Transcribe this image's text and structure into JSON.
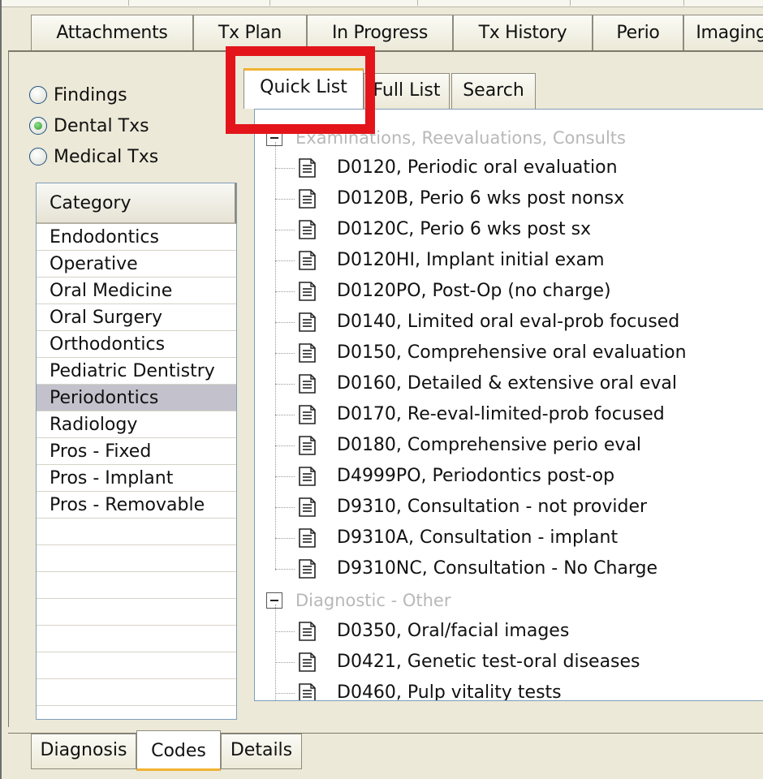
{
  "top_tabs": [
    "Attachments",
    "Tx Plan",
    "In Progress",
    "Tx History",
    "Perio",
    "Imaging"
  ],
  "radios": [
    {
      "label": "Findings",
      "checked": false
    },
    {
      "label": "Dental Txs",
      "checked": true
    },
    {
      "label": "Medical Txs",
      "checked": false
    }
  ],
  "category": {
    "header": "Category",
    "items": [
      "Endodontics",
      "Operative",
      "Oral Medicine",
      "Oral Surgery",
      "Orthodontics",
      "Pediatric Dentistry",
      "Periodontics",
      "Radiology",
      "Pros - Fixed",
      "Pros - Implant",
      "Pros - Removable"
    ],
    "selected": "Periodontics"
  },
  "inner_tabs": [
    "Quick List",
    "Full List",
    "Search"
  ],
  "active_inner_tab": "Quick List",
  "tree": {
    "group1": "Examinations, Reevaluations, Consults",
    "group1_items": [
      "D0120, Periodic oral evaluation",
      "D0120B, Perio 6 wks post nonsx",
      "D0120C, Perio 6 wks post sx",
      "D0120HI, Implant initial exam",
      "D0120PO, Post-Op (no charge)",
      "D0140, Limited oral eval-prob focused",
      "D0150, Comprehensive oral evaluation",
      "D0160, Detailed & extensive oral eval",
      "D0170, Re-eval-limited-prob focused",
      "D0180, Comprehensive perio eval",
      "D4999PO, Periodontics post-op",
      "D9310, Consultation - not provider",
      "D9310A, Consultation - implant",
      "D9310NC, Consultation - No Charge"
    ],
    "group2": "Diagnostic - Other",
    "group2_items": [
      "D0350, Oral/facial images",
      "D0421, Genetic test-oral diseases",
      "D0460, Pulp vitality tests"
    ]
  },
  "bottom_tabs": [
    "Diagnosis",
    "Codes",
    "Details"
  ],
  "active_bottom_tab": "Codes",
  "colors": {
    "highlight": "#e3151b",
    "active_tab_accent": "#f0b331",
    "selected_row": "#c3c2cc"
  }
}
